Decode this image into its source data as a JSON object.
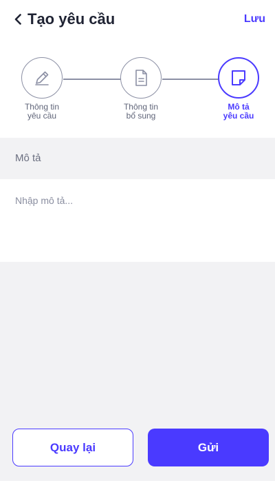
{
  "header": {
    "title": "Tạo yêu cầu",
    "save_label": "Lưu"
  },
  "steps": [
    {
      "label": "Thông tin\nyêu cầu",
      "icon": "pencil-icon",
      "active": false
    },
    {
      "label": "Thông tin\nbổ sung",
      "icon": "document-icon",
      "active": false
    },
    {
      "label": "Mô tả\nyêu cầu",
      "icon": "sticky-note-icon",
      "active": true
    }
  ],
  "section": {
    "title": "Mô tả"
  },
  "description": {
    "value": "",
    "placeholder": "Nhập mô tả..."
  },
  "actions": {
    "back_label": "Quay lại",
    "send_label": "Gửi"
  },
  "colors": {
    "accent": "#4a3aff",
    "inactive": "#8b8fa4",
    "panel_bg": "#f2f2f4"
  }
}
